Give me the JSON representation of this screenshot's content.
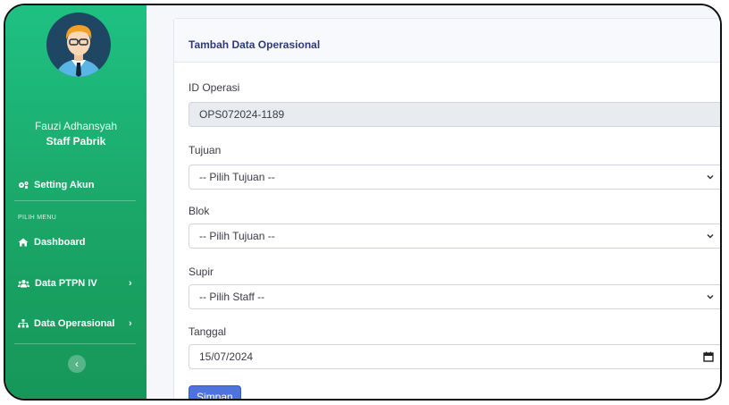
{
  "user": {
    "name": "Fauzi Adhansyah",
    "role": "Staff Pabrik"
  },
  "sidebar": {
    "setting_label": "Setting Akun",
    "section_label": "PILIH MENU",
    "items": [
      {
        "label": "Dashboard",
        "icon": "home-icon"
      },
      {
        "label": "Data PTPN IV",
        "icon": "users-icon",
        "has_submenu": true
      },
      {
        "label": "Data Operasional",
        "icon": "sitemap-icon",
        "has_submenu": true
      }
    ],
    "collapse_icon": "chevron-left-icon"
  },
  "form": {
    "title": "Tambah Data Operasional",
    "fields": [
      {
        "label": "ID Operasi",
        "value": "OPS072024-1189",
        "readonly": true
      },
      {
        "label": "Tujuan",
        "value": "-- Pilih Tujuan --",
        "type": "select"
      },
      {
        "label": "Blok",
        "value": "-- Pilih Tujuan --",
        "type": "select"
      },
      {
        "label": "Supir",
        "value": "-- Pilih Staff --",
        "type": "select"
      },
      {
        "label": "Tanggal",
        "value": "15/07/2024",
        "type": "date"
      }
    ],
    "submit_label": "Simpan"
  },
  "colors": {
    "sidebar_top": "#1ec183",
    "sidebar_bottom": "#169759",
    "primary": "#4e73df",
    "title": "#2e3a78"
  }
}
